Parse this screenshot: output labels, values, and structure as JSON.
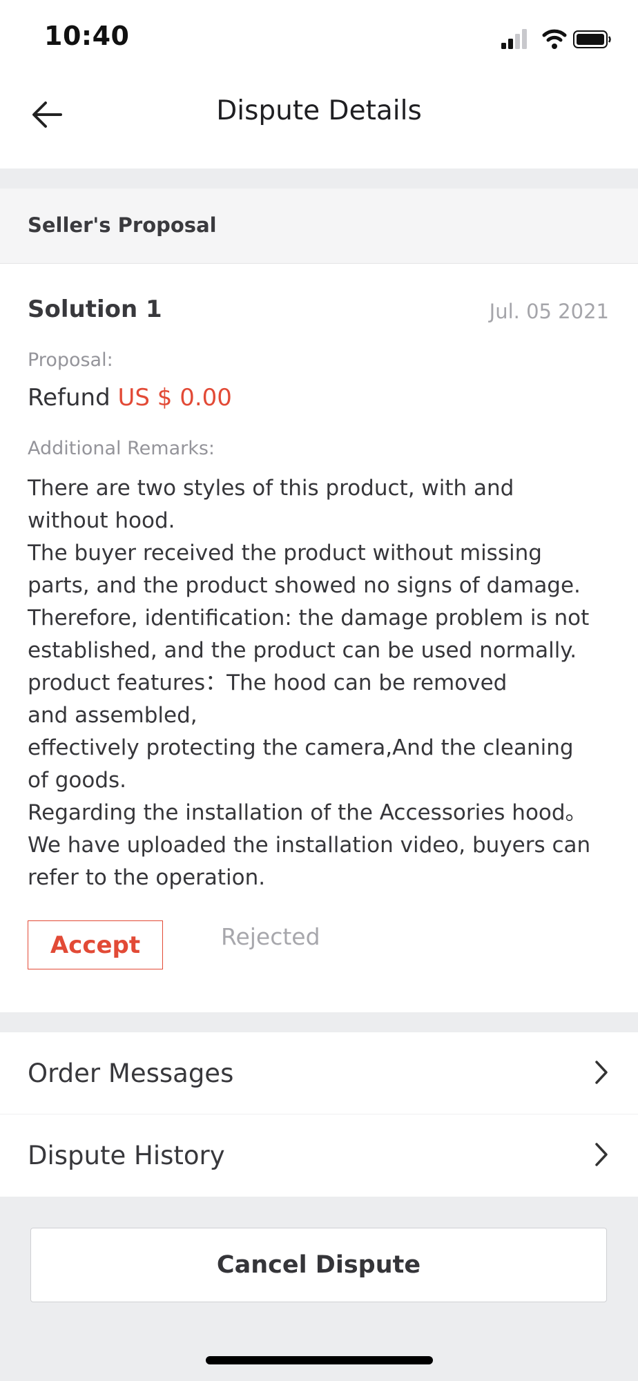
{
  "status_bar": {
    "time": "10:40"
  },
  "nav": {
    "title": "Dispute Details"
  },
  "proposal_section": {
    "header": "Seller's Proposal",
    "solution_title": "Solution 1",
    "date": "Jul. 05 2021",
    "proposal_label": "Proposal:",
    "proposal_action": "Refund",
    "proposal_amount": "US $ 0.00",
    "remarks_label": "Additional Remarks:",
    "remarks_lines": [
      "There are two styles of this product, with and",
      "without hood.",
      "The buyer received the product without missing",
      "parts, and the product showed no signs of damage.",
      "Therefore, identification: the damage problem is not",
      "established, and the product can be used normally.",
      "product features：The hood can be removed",
      "and assembled,",
      "effectively protecting the camera,And the cleaning",
      "of goods.",
      "Regarding the installation of the Accessories hood。",
      "We have uploaded the installation video, buyers can",
      "refer to the operation."
    ],
    "accept_label": "Accept",
    "rejected_label": "Rejected"
  },
  "links": {
    "order_messages": "Order Messages",
    "dispute_history": "Dispute History"
  },
  "footer": {
    "cancel_label": "Cancel Dispute"
  },
  "colors": {
    "accent_red": "#e24a36",
    "background_gray": "#ecedef",
    "muted_text": "#a5a5aa"
  },
  "icons": {
    "back": "arrow-left-icon",
    "chevron": "chevron-right-icon",
    "signal": "cellular-signal-icon",
    "wifi": "wifi-icon",
    "battery": "battery-icon"
  }
}
